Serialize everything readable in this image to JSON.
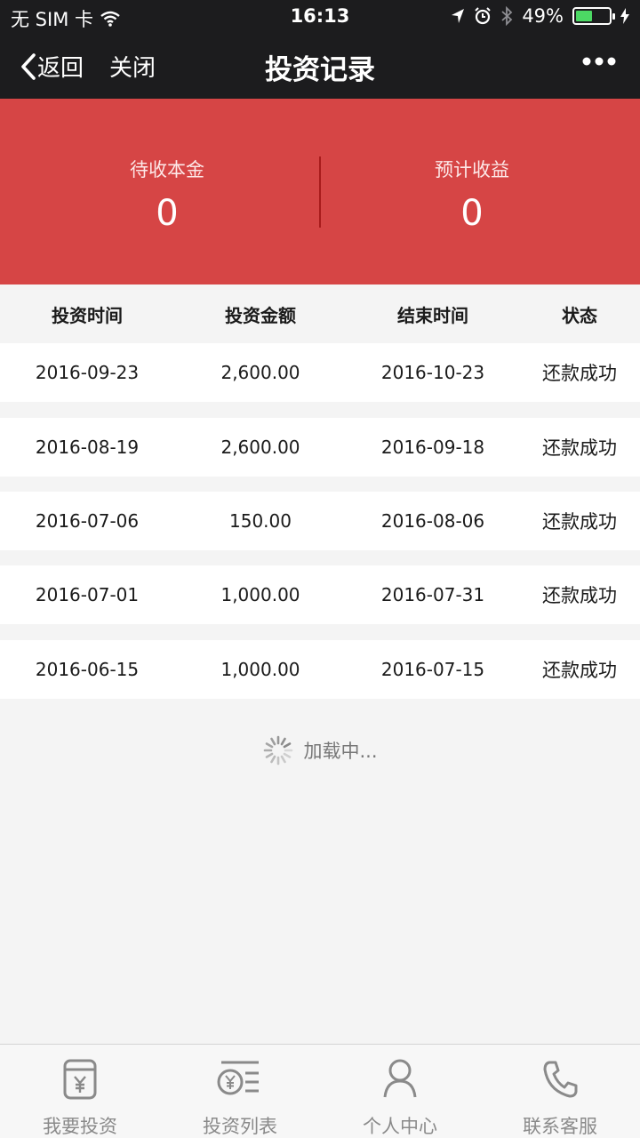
{
  "status_bar": {
    "carrier": "无 SIM 卡",
    "time": "16:13",
    "battery_percent": "49%",
    "battery_level": 0.49
  },
  "nav": {
    "back_label": "返回",
    "close_label": "关闭",
    "title": "投资记录"
  },
  "summary": {
    "pending_principal_label": "待收本金",
    "pending_principal_value": "0",
    "expected_income_label": "预计收益",
    "expected_income_value": "0"
  },
  "table": {
    "headers": [
      "投资时间",
      "投资金额",
      "结束时间",
      "状态"
    ],
    "rows": [
      {
        "invest_time": "2016-09-23",
        "amount": "2,600.00",
        "end_time": "2016-10-23",
        "status": "还款成功"
      },
      {
        "invest_time": "2016-08-19",
        "amount": "2,600.00",
        "end_time": "2016-09-18",
        "status": "还款成功"
      },
      {
        "invest_time": "2016-07-06",
        "amount": "150.00",
        "end_time": "2016-08-06",
        "status": "还款成功"
      },
      {
        "invest_time": "2016-07-01",
        "amount": "1,000.00",
        "end_time": "2016-07-31",
        "status": "还款成功"
      },
      {
        "invest_time": "2016-06-15",
        "amount": "1,000.00",
        "end_time": "2016-07-15",
        "status": "还款成功"
      }
    ]
  },
  "loading_text": "加载中...",
  "tabbar": {
    "items": [
      {
        "label": "我要投资",
        "icon": "wallet-yen-icon"
      },
      {
        "label": "投资列表",
        "icon": "yen-list-icon"
      },
      {
        "label": "个人中心",
        "icon": "person-icon"
      },
      {
        "label": "联系客服",
        "icon": "phone-icon"
      }
    ]
  },
  "colors": {
    "banner_red": "#d64545",
    "bar_dark": "#1c1c1e",
    "tab_gray": "#8a8a8a"
  }
}
